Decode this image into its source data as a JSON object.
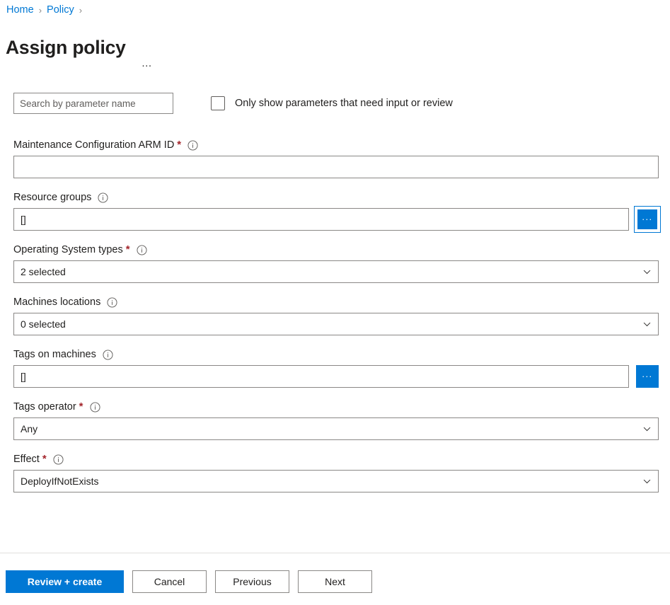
{
  "breadcrumb": {
    "items": [
      {
        "label": "Home",
        "separator": "›"
      },
      {
        "label": "Policy",
        "separator": "›"
      }
    ],
    "sep1": "›",
    "sep2": "›"
  },
  "header": {
    "title": "Assign policy",
    "more_menu": "…"
  },
  "filters": {
    "search_placeholder": "Search by parameter name",
    "search_value": "",
    "checkbox_label": "Only show parameters that need input or review",
    "checkbox_checked": false
  },
  "fields": [
    {
      "label": "Maintenance Configuration ARM ID",
      "required": true,
      "star": "*",
      "info": "info-icon",
      "control": "text",
      "value": "",
      "has_picker": false
    },
    {
      "label": "Resource groups",
      "required": false,
      "star": "",
      "info": "info-icon",
      "control": "text",
      "value": "[]",
      "has_picker": true,
      "picker_label": "...",
      "picker_focused": true
    },
    {
      "label": "Operating System types",
      "required": true,
      "star": "*",
      "info": "info-icon",
      "control": "select",
      "value": "2 selected",
      "has_picker": false
    },
    {
      "label": "Machines locations",
      "required": false,
      "star": "",
      "info": "info-icon",
      "control": "select",
      "value": "0 selected",
      "has_picker": false
    },
    {
      "label": "Tags on machines",
      "required": false,
      "star": "",
      "info": "info-icon",
      "control": "text",
      "value": "[]",
      "has_picker": true,
      "picker_label": "...",
      "picker_focused": false
    },
    {
      "label": "Tags operator",
      "required": true,
      "star": "*",
      "info": "info-icon",
      "control": "select",
      "value": "Any",
      "has_picker": false
    },
    {
      "label": "Effect",
      "required": true,
      "star": "*",
      "info": "info-icon",
      "control": "select",
      "value": "DeployIfNotExists",
      "has_picker": false
    }
  ],
  "footer": {
    "review_create_label": "Review + create",
    "cancel_label": "Cancel",
    "previous_label": "Previous",
    "next_label": "Next"
  },
  "colors": {
    "accent": "#0078d4",
    "link": "#0078d4",
    "required_star": "#a4262c",
    "border": "#8a8886",
    "text": "#201f1e"
  }
}
